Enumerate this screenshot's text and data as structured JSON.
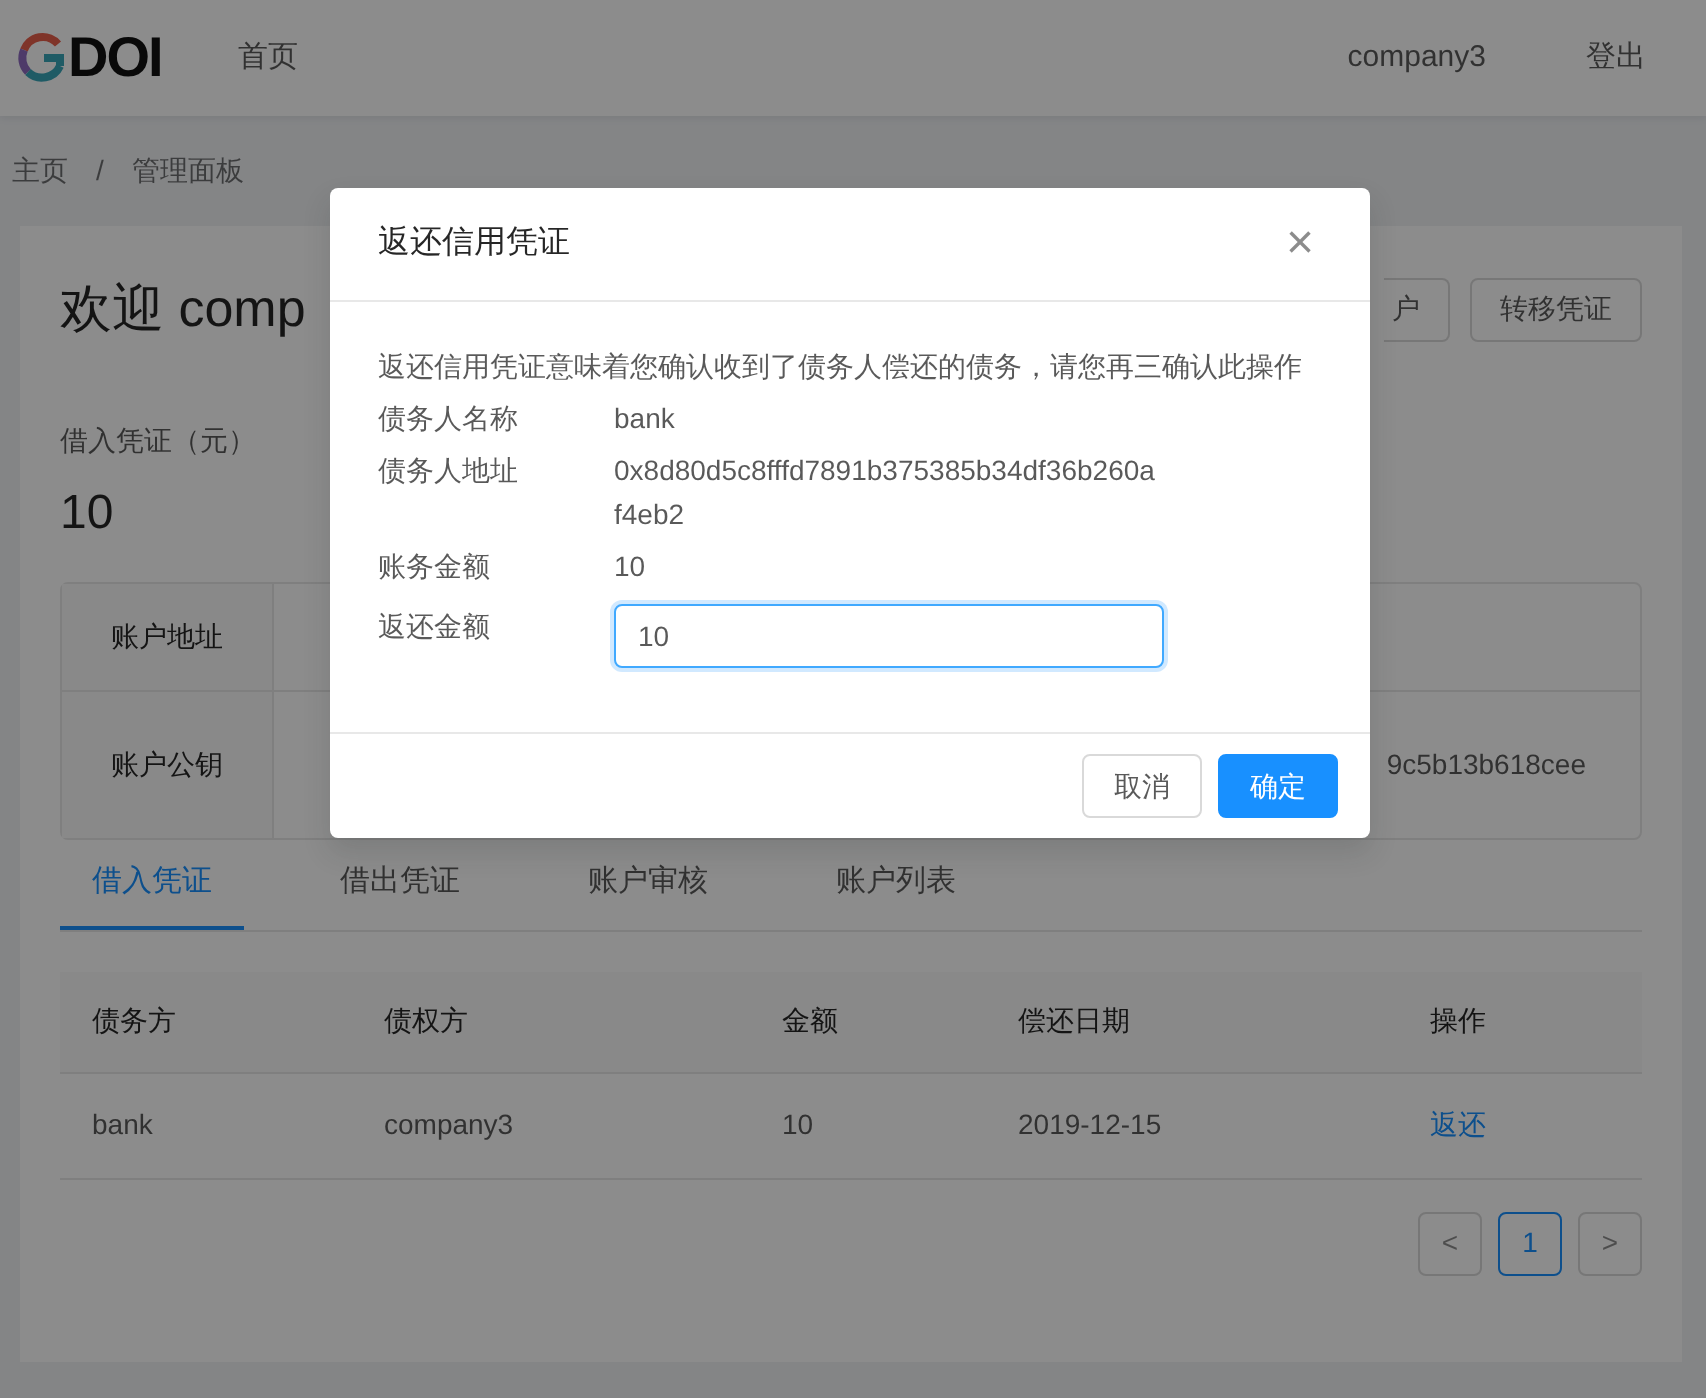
{
  "header": {
    "logo_text": "DOI",
    "nav": [
      {
        "label": "首页",
        "selected": false
      }
    ],
    "user": "company3",
    "logout": "登出"
  },
  "breadcrumb": {
    "items": [
      "主页",
      "管理面板"
    ],
    "separator": "/"
  },
  "page": {
    "title": "欢迎 comp",
    "actions": [
      "户",
      "转移凭证"
    ],
    "stat": {
      "label": "借入凭证（元）",
      "value": "10"
    },
    "info": [
      {
        "label": "账户地址"
      },
      {
        "label": "账户公钥",
        "value": "9c5b13b618cee"
      }
    ],
    "tabs": [
      {
        "label": "借入凭证",
        "selected": true
      },
      {
        "label": "借出凭证",
        "selected": false
      },
      {
        "label": "账户审核",
        "selected": false
      },
      {
        "label": "账户列表",
        "selected": false
      }
    ],
    "table": {
      "columns": [
        "债务方",
        "债权方",
        "金额",
        "偿还日期",
        "操作"
      ],
      "rows": [
        [
          "bank",
          "company3",
          "10",
          "2019-12-15",
          "返还"
        ]
      ]
    },
    "pagination": {
      "prev": "<",
      "pages": [
        {
          "label": "1",
          "selected": true
        }
      ],
      "next": ">"
    }
  },
  "modal": {
    "title": "返还信用凭证",
    "close": "×",
    "message": "返还信用凭证意味着您确认收到了债务人偿还的债务，请您再三确认此操作",
    "fields": [
      {
        "kind": "text",
        "label": "债务人名称",
        "value": "bank"
      },
      {
        "kind": "text",
        "label": "债务人地址",
        "value": "0x8d80d5c8fffd7891b375385b34df36b260af4eb2"
      },
      {
        "kind": "text",
        "label": "账务金额",
        "value": "10"
      },
      {
        "kind": "input",
        "label": "返还金额",
        "value": "10"
      }
    ],
    "buttons": [
      {
        "label": "取消",
        "primary": false
      },
      {
        "label": "确定",
        "primary": true
      }
    ]
  }
}
